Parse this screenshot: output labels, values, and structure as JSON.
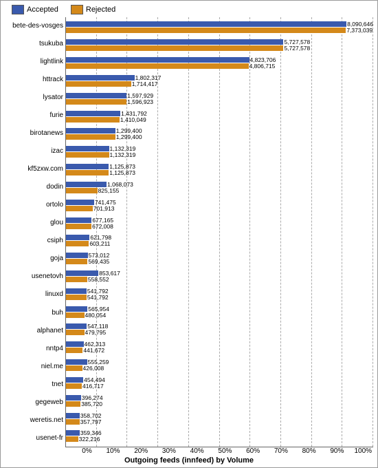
{
  "legend": {
    "accepted_label": "Accepted",
    "rejected_label": "Rejected"
  },
  "x_axis_title": "Outgoing feeds (innfeed) by Volume",
  "x_ticks": [
    "0%",
    "10%",
    "20%",
    "30%",
    "40%",
    "50%",
    "60%",
    "70%",
    "80%",
    "90%",
    "100%"
  ],
  "max_value": 8090646,
  "bars": [
    {
      "label": "bete-des-vosges",
      "accepted": 8090646,
      "rejected": 7373039
    },
    {
      "label": "tsukuba",
      "accepted": 5727578,
      "rejected": 5727578
    },
    {
      "label": "lightlink",
      "accepted": 4823706,
      "rejected": 4806715
    },
    {
      "label": "httrack",
      "accepted": 1802317,
      "rejected": 1714417
    },
    {
      "label": "lysator",
      "accepted": 1597929,
      "rejected": 1596923
    },
    {
      "label": "furie",
      "accepted": 1431792,
      "rejected": 1410049
    },
    {
      "label": "birotanews",
      "accepted": 1299400,
      "rejected": 1299400
    },
    {
      "label": "izac",
      "accepted": 1132319,
      "rejected": 1132319
    },
    {
      "label": "kf5zxw.com",
      "accepted": 1125873,
      "rejected": 1125873
    },
    {
      "label": "dodin",
      "accepted": 1068073,
      "rejected": 825155
    },
    {
      "label": "ortolo",
      "accepted": 741475,
      "rejected": 701913
    },
    {
      "label": "glou",
      "accepted": 677165,
      "rejected": 672008
    },
    {
      "label": "csiph",
      "accepted": 621798,
      "rejected": 603211
    },
    {
      "label": "goja",
      "accepted": 573012,
      "rejected": 569435
    },
    {
      "label": "usenetovh",
      "accepted": 853617,
      "rejected": 558552
    },
    {
      "label": "linuxd",
      "accepted": 541792,
      "rejected": 541792
    },
    {
      "label": "buh",
      "accepted": 565954,
      "rejected": 480054
    },
    {
      "label": "alphanet",
      "accepted": 547118,
      "rejected": 479795
    },
    {
      "label": "nntp4",
      "accepted": 462313,
      "rejected": 441672
    },
    {
      "label": "niel.me",
      "accepted": 555259,
      "rejected": 426008
    },
    {
      "label": "tnet",
      "accepted": 454494,
      "rejected": 416717
    },
    {
      "label": "gegeweb",
      "accepted": 396274,
      "rejected": 385720
    },
    {
      "label": "weretis.net",
      "accepted": 358702,
      "rejected": 357797
    },
    {
      "label": "usenet-fr",
      "accepted": 359346,
      "rejected": 322216
    }
  ]
}
